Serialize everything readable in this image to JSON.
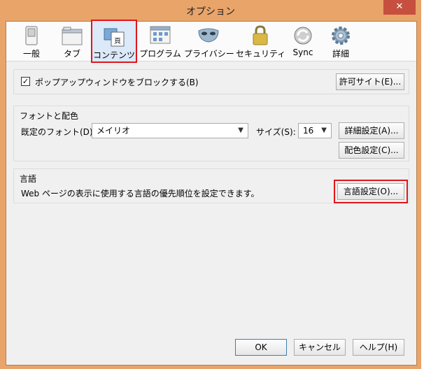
{
  "window": {
    "title": "オプション",
    "close_label": "✕"
  },
  "toolbar": {
    "items": [
      {
        "label": "一般",
        "icon": "switch-icon"
      },
      {
        "label": "タブ",
        "icon": "tabs-icon"
      },
      {
        "label": "コンテンツ",
        "icon": "content-page-icon"
      },
      {
        "label": "プログラム",
        "icon": "applications-icon"
      },
      {
        "label": "プライバシー",
        "icon": "mask-icon"
      },
      {
        "label": "セキュリティ",
        "icon": "padlock-icon"
      },
      {
        "label": "Sync",
        "icon": "sync-icon"
      },
      {
        "label": "詳細",
        "icon": "gear-icon"
      }
    ],
    "selected": "コンテンツ"
  },
  "popup": {
    "checkbox_label": "ポップアップウィンドウをブロックする(B)",
    "checked": true,
    "exceptions_button": "許可サイト(E)..."
  },
  "fonts": {
    "title": "フォントと配色",
    "default_font_label": "既定のフォント(D):",
    "default_font_value": "メイリオ",
    "size_label": "サイズ(S):",
    "size_value": "16",
    "advanced_button": "詳細設定(A)...",
    "colors_button": "配色設定(C)..."
  },
  "languages": {
    "title": "言語",
    "description": "Web ページの表示に使用する言語の優先順位を設定できます。",
    "choose_button": "言語設定(O)..."
  },
  "footer": {
    "ok": "OK",
    "cancel": "キャンセル",
    "help": "ヘルプ(H)"
  },
  "colors": {
    "titlebar": "#e9a46a",
    "close": "#c74f3f",
    "highlight": "#e0161b"
  }
}
